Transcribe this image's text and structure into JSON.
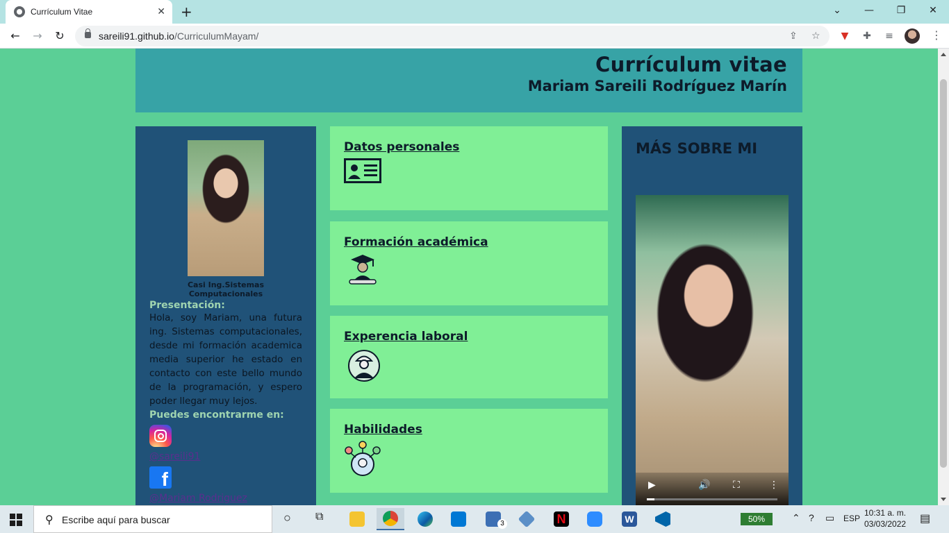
{
  "browser": {
    "tab_title": "Currículum Vitae",
    "tab_close": "✕",
    "new_tab": "+",
    "url_host": "sareili91.github.io",
    "url_path": "/CurriculumMayam/",
    "win_controls": [
      "⌄",
      "—",
      "❐",
      "✕"
    ]
  },
  "header": {
    "title": "Currículum vitae",
    "name": "Mariam Sareili Rodríguez Marín"
  },
  "profile": {
    "subtitle": "Casi Ing.Sistemas Computacionales",
    "presentation_label": "Presentación:",
    "bio": "Hola, soy Mariam, una futura ing. Sistemas computacionales, desde mi formación academica media superior he estado en contacto con este bello mundo de la programación, y espero poder llegar muy lejos.",
    "find_me_label": "Puedes encontrarme en:",
    "instagram_handle": "@sareili91",
    "facebook_handle": "@Mariam Rodriguez"
  },
  "sections": [
    {
      "label": "Datos personales",
      "icon": "id-card-icon"
    },
    {
      "label": "Formación académica",
      "icon": "graduate-icon"
    },
    {
      "label": "Experencia laboral",
      "icon": "worker-icon"
    },
    {
      "label": "Habilidades",
      "icon": "skills-icon"
    }
  ],
  "more": {
    "title": "MÁS SOBRE MI",
    "video_progress": 0.06
  },
  "taskbar": {
    "search_placeholder": "Escribe aquí para buscar",
    "battery": "50%",
    "language": "ESP",
    "time": "10:31 a. m.",
    "date": "03/03/2022",
    "mail_badge": "3"
  },
  "colors": {
    "page_bg": "#5bcf96",
    "header_bg": "#37a3a6",
    "side_panel_bg": "#205278",
    "card_bg": "#80ef96"
  }
}
